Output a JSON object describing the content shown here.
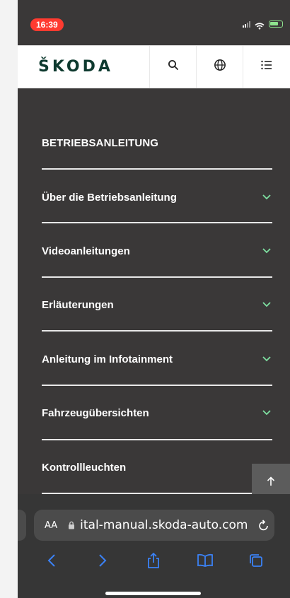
{
  "status": {
    "time": "16:39"
  },
  "header": {
    "logo": "ŠKODA"
  },
  "menu": {
    "title": "BETRIEBSANLEITUNG",
    "items": [
      {
        "label": "Über die Betriebsanleitung"
      },
      {
        "label": "Videoanleitungen"
      },
      {
        "label": "Erläuterungen"
      },
      {
        "label": "Anleitung im Infotainment"
      },
      {
        "label": "Fahrzeugübersichten"
      },
      {
        "label": "Kontrollleuchten"
      }
    ]
  },
  "browser": {
    "text_size": "AA",
    "url": "ital-manual.skoda-auto.com"
  },
  "colors": {
    "accent": "#7ee0a1",
    "background": "#3a3838",
    "urlbar": "#4b4b4b",
    "time_pill": "#ff3b30"
  }
}
